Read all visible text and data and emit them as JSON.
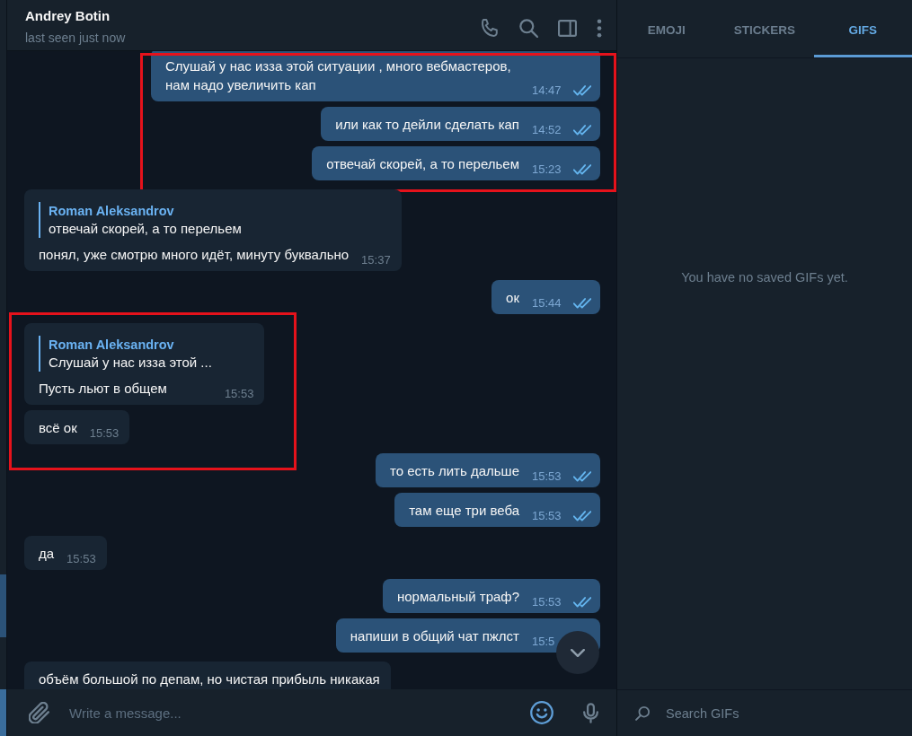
{
  "chat_header": {
    "name": "Andrey Botin",
    "status": "last seen just now"
  },
  "groups": [
    {
      "highlighted": true,
      "messages": [
        {
          "outgoing": true,
          "text": "Слушай у нас изза этой ситуации , много вебмастеров, нам надо увеличить кап",
          "time": "14:47",
          "read": true
        },
        {
          "outgoing": true,
          "text": "или как то дейли сделать кап",
          "time": "14:52",
          "read": true
        },
        {
          "outgoing": true,
          "text": "отвечай скорей, а то перельем",
          "time": "15:23",
          "read": true
        }
      ]
    },
    {
      "highlighted": false,
      "messages": [
        {
          "outgoing": false,
          "reply": {
            "author": "Roman Aleksandrov",
            "text": "отвечай скорей, а то перельем"
          },
          "text": "понял, уже смотрю много идёт, минуту буквально",
          "time": "15:37"
        },
        {
          "outgoing": true,
          "text": "ок",
          "time": "15:44",
          "read": true
        }
      ]
    },
    {
      "highlighted": true,
      "messages": [
        {
          "outgoing": false,
          "reply": {
            "author": "Roman Aleksandrov",
            "text": "Слушай у нас изза этой ..."
          },
          "text": "Пусть льют в общем",
          "time": "15:53"
        },
        {
          "outgoing": false,
          "text": "всё ок",
          "time": "15:53"
        }
      ]
    },
    {
      "highlighted": false,
      "messages": [
        {
          "outgoing": true,
          "text": "то есть лить дальше",
          "time": "15:53",
          "read": true
        },
        {
          "outgoing": true,
          "text": "там еще три веба",
          "time": "15:53",
          "read": true
        },
        {
          "outgoing": false,
          "text": "да",
          "time": "15:53"
        },
        {
          "outgoing": true,
          "text": "нормальный траф?",
          "time": "15:53",
          "read": true
        },
        {
          "outgoing": true,
          "text": "напиши в общий чат пжлст",
          "time": "15:5"
        },
        {
          "outgoing": false,
          "text": "объём большой по депам, но чистая прибыль никакая"
        }
      ]
    }
  ],
  "composer": {
    "placeholder": "Write a message..."
  },
  "side_panel": {
    "tabs": [
      {
        "label": "EMOJI",
        "selected": false
      },
      {
        "label": "STICKERS",
        "selected": false
      },
      {
        "label": "GIFS",
        "selected": true
      }
    ],
    "empty_text": "You have no saved GIFs yet.",
    "search": {
      "placeholder": "Search GIFs"
    }
  }
}
